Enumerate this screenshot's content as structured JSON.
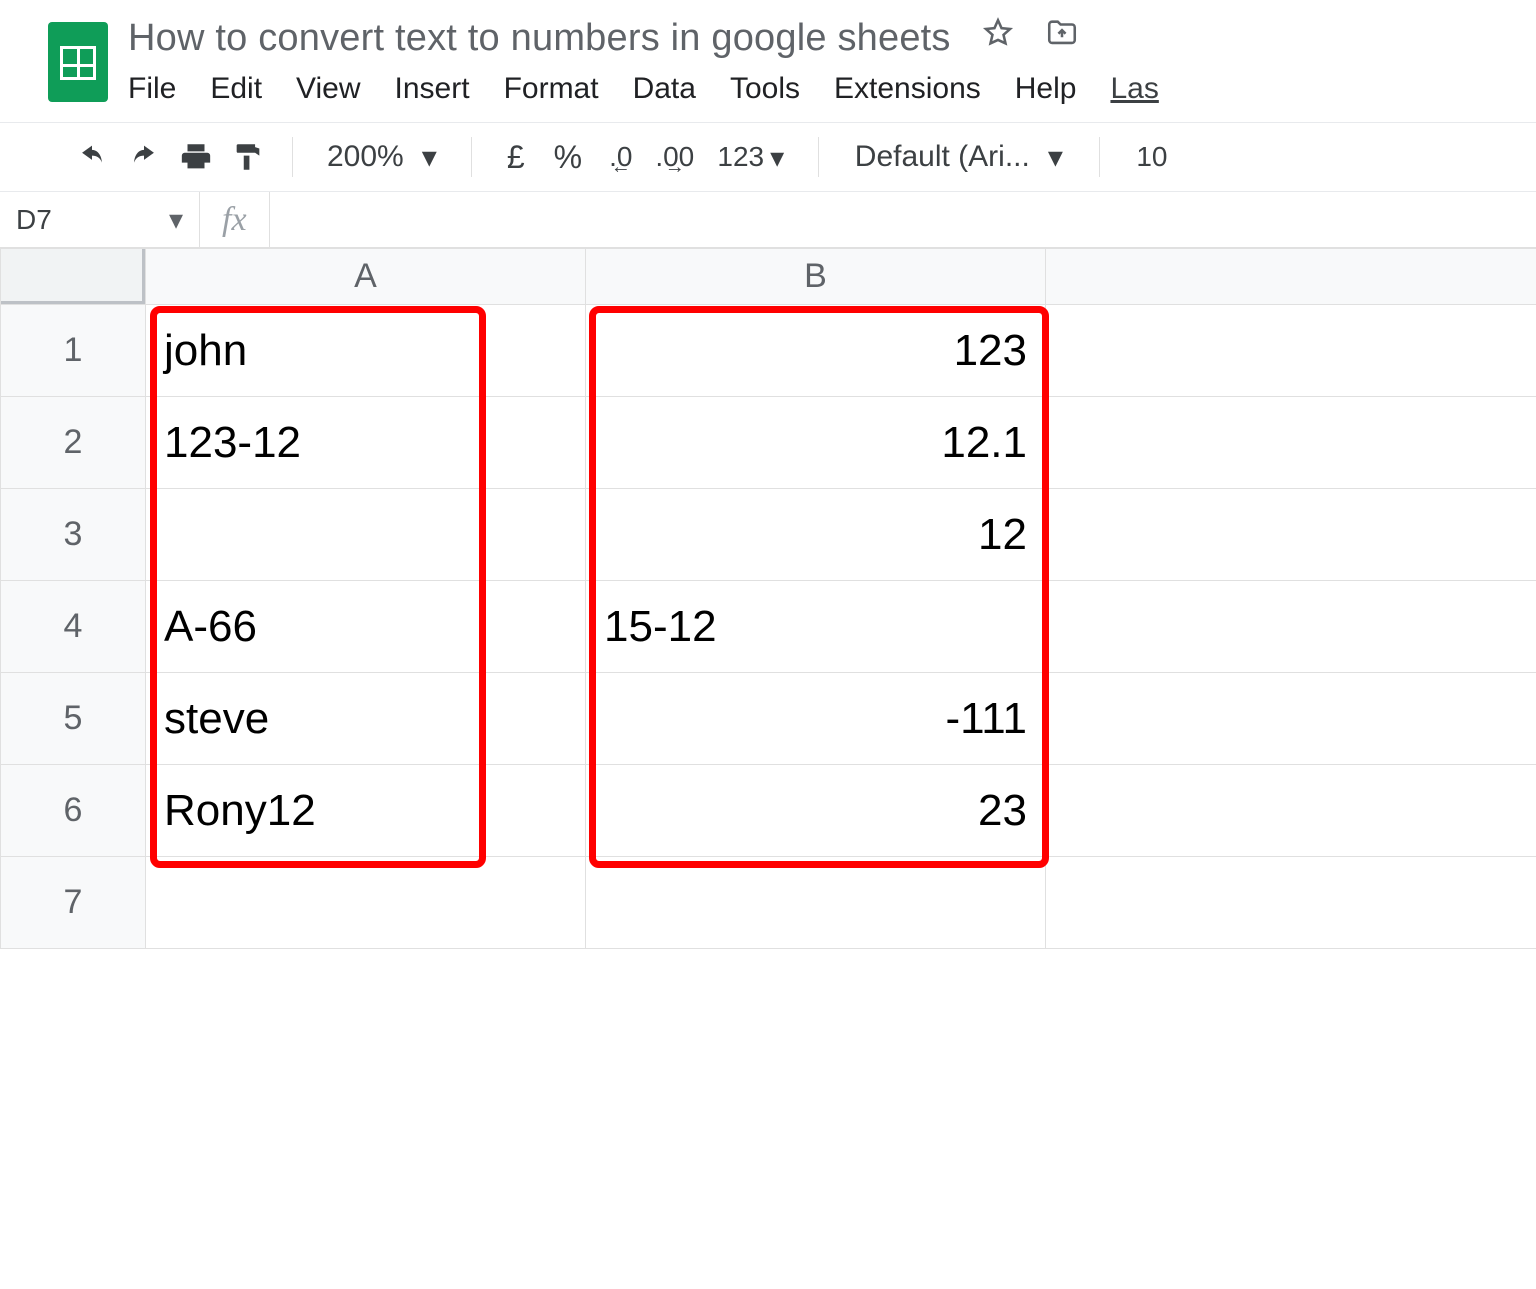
{
  "doc": {
    "title": "How to convert text to numbers in google sheets"
  },
  "menus": {
    "file": "File",
    "edit": "Edit",
    "view": "View",
    "insert": "Insert",
    "format": "Format",
    "data": "Data",
    "tools": "Tools",
    "extensions": "Extensions",
    "help": "Help",
    "last": "Las"
  },
  "toolbar": {
    "zoom": "200%",
    "currency": "£",
    "percent": "%",
    "dec_less": ".0",
    "dec_more": ".00",
    "more_formats": "123",
    "font_name": "Default (Ari...",
    "font_size": "10"
  },
  "fx": {
    "cell_ref": "D7",
    "fx_label": "fx",
    "formula": ""
  },
  "grid": {
    "columns": [
      "A",
      "B"
    ],
    "row_headers": [
      "1",
      "2",
      "3",
      "4",
      "5",
      "6",
      "7"
    ],
    "cells": {
      "A1": "john",
      "A2": "123-12",
      "A3": "",
      "A4": "A-66",
      "A5": "steve",
      "A6": "Rony12",
      "A7": "",
      "B1": "123",
      "B2": "12.1",
      "B3": "12",
      "B4": "15-12",
      "B5": "-111",
      "B6": "23",
      "B7": ""
    }
  }
}
